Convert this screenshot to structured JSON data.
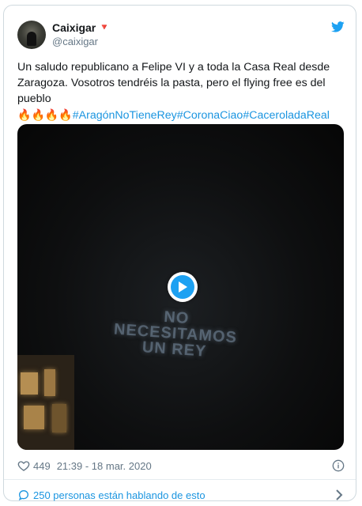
{
  "author": {
    "display_name": "Caixigar",
    "name_emoji": "🔻",
    "handle": "@caixigar"
  },
  "tweet": {
    "text": "Un saludo republicano a Felipe VI y a toda la Casa Real desde Zaragoza. Vosotros tendréis la pasta, pero el flying free es del pueblo",
    "fire_emojis": [
      "🔥",
      "🔥",
      "🔥",
      "🔥"
    ],
    "hashtags": [
      "#AragónNoTieneRey",
      "#CoronaCiao",
      "#CaceroladaReal"
    ]
  },
  "media": {
    "projected_text": [
      "NO",
      "NECESITAMOS",
      "UN REY"
    ],
    "play_icon": "play-icon"
  },
  "meta": {
    "like_count": "449",
    "timestamp": "21:39 - 18 mar. 2020"
  },
  "footer": {
    "conversation_text": "250 personas están hablando de esto"
  },
  "colors": {
    "link": "#1b95e0",
    "twitter_blue": "#1da1f2",
    "muted": "#657786",
    "border": "#cfd9de"
  }
}
